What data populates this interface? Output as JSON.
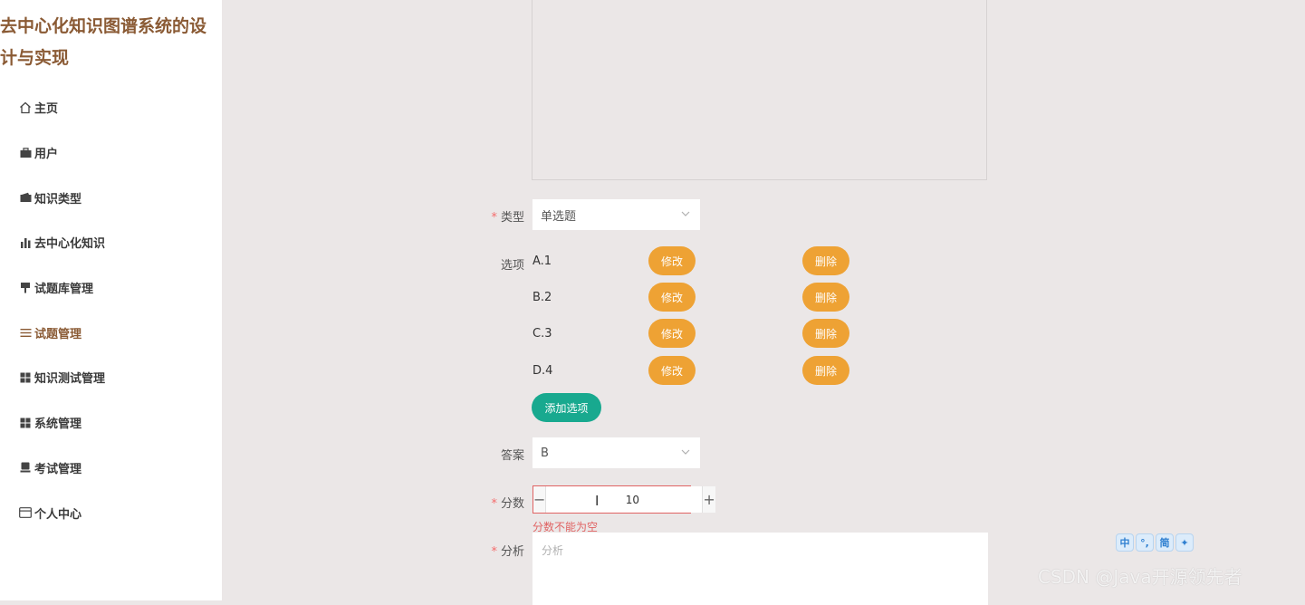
{
  "app": {
    "title": "去中心化知识图谱系统的设计与实现"
  },
  "sidebar": {
    "items": [
      {
        "label": "主页",
        "icon": "home-icon"
      },
      {
        "label": "用户",
        "icon": "briefcase-icon"
      },
      {
        "label": "知识类型",
        "icon": "wallet-icon"
      },
      {
        "label": "去中心化知识",
        "icon": "bar-chart-icon"
      },
      {
        "label": "试题库管理",
        "icon": "pin-icon"
      },
      {
        "label": "试题管理",
        "icon": "list-icon",
        "active": true
      },
      {
        "label": "知识测试管理",
        "icon": "grid-icon"
      },
      {
        "label": "系统管理",
        "icon": "grid-icon"
      },
      {
        "label": "考试管理",
        "icon": "stamp-icon"
      },
      {
        "label": "个人中心",
        "icon": "card-icon"
      }
    ]
  },
  "form": {
    "type_label": "类型",
    "type_value": "单选题",
    "options_label": "选项",
    "options": [
      {
        "text": "A.1",
        "edit": "修改",
        "delete": "删除"
      },
      {
        "text": "B.2",
        "edit": "修改",
        "delete": "删除"
      },
      {
        "text": "C.3",
        "edit": "修改",
        "delete": "删除"
      },
      {
        "text": "D.4",
        "edit": "修改",
        "delete": "删除"
      }
    ],
    "add_option_label": "添加选项",
    "answer_label": "答案",
    "answer_value": "B",
    "score_label": "分数",
    "score_value": "10",
    "score_error": "分数不能为空",
    "analysis_label": "分析",
    "analysis_placeholder": "分析"
  },
  "overlay": {
    "ime_icons": [
      "中",
      "°,",
      "简",
      "✦"
    ],
    "watermark": "CSDN @Java开源领先者"
  },
  "colors": {
    "accent": "#8a5a34",
    "orange": "#eea234",
    "teal": "#18a98f",
    "error": "#e06363"
  }
}
